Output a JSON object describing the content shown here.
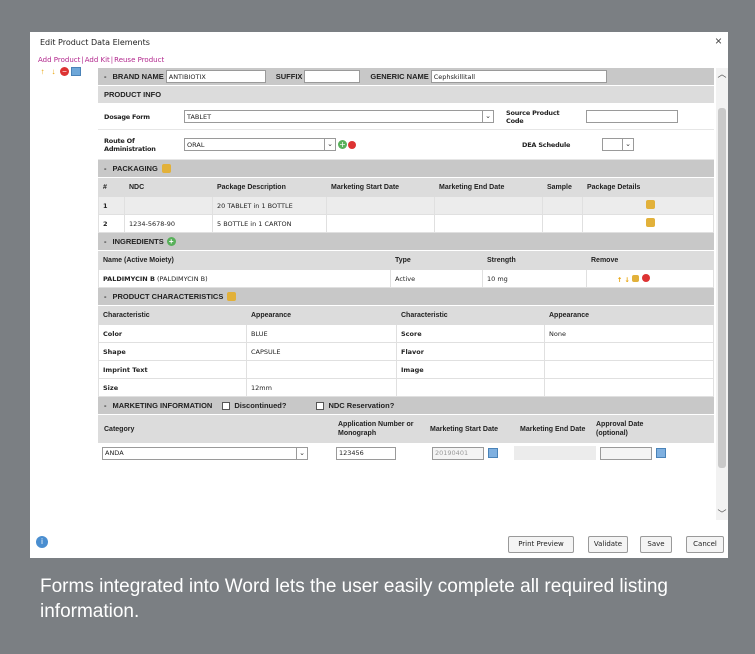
{
  "dialog": {
    "title": "Edit Product Data Elements",
    "close": "×",
    "links": [
      "Add Product",
      "Add Kit",
      "Reuse Product"
    ]
  },
  "brand": {
    "brand_label": "BRAND NAME",
    "brand_value": "ANTIBIOTIX",
    "suffix_label": "SUFFIX",
    "suffix_value": "",
    "generic_label": "GENERIC NAME",
    "generic_value": "Cephskillitall"
  },
  "product_info": {
    "header": "PRODUCT INFO",
    "dosage_label": "Dosage Form",
    "dosage_value": "TABLET",
    "source_label": "Source Product Code",
    "route_label": "Route Of Administration",
    "route_value": "ORAL",
    "dea_label": "DEA Schedule",
    "dea_value": ""
  },
  "packaging": {
    "header": "PACKAGING",
    "columns": [
      "#",
      "NDC",
      "Package Description",
      "Marketing Start Date",
      "Marketing End Date",
      "Sample",
      "Package Details"
    ],
    "rows": [
      {
        "num": "1",
        "ndc": "",
        "desc": "20 TABLET in 1 BOTTLE"
      },
      {
        "num": "2",
        "ndc": "1234-5678-90",
        "desc": "5 BOTTLE in 1 CARTON"
      }
    ]
  },
  "ingredients": {
    "header": "INGREDIENTS",
    "columns": [
      "Name (Active Moiety)",
      "Type",
      "Strength",
      "Remove"
    ],
    "row": {
      "name_bold": "PALDIMYCIN B",
      "name_rest": " (PALDIMYCIN B)",
      "type": "Active",
      "strength": "10 mg"
    }
  },
  "characteristics": {
    "header": "PRODUCT CHARACTERISTICS",
    "columns": [
      "Characteristic",
      "Appearance",
      "Characteristic",
      "Appearance"
    ],
    "rows": [
      {
        "c1": "Color",
        "a1": "BLUE",
        "c2": "Score",
        "a2": "None"
      },
      {
        "c1": "Shape",
        "a1": "CAPSULE",
        "c2": "Flavor",
        "a2": ""
      },
      {
        "c1": "Imprint Text",
        "a1": "",
        "c2": "Image",
        "a2": ""
      },
      {
        "c1": "Size",
        "a1": "12mm",
        "c2": "",
        "a2": ""
      }
    ]
  },
  "marketing": {
    "header": "MARKETING INFORMATION",
    "discontinued_label": "Discontinued?",
    "ndc_reservation_label": "NDC Reservation?",
    "columns": {
      "category": "Category",
      "application": "Application Number or Monograph",
      "start": "Marketing Start Date",
      "end": "Marketing End Date",
      "approval": "Approval Date (optional)"
    },
    "category_value": "ANDA",
    "application_value": "123456",
    "start_value": "20190401",
    "approval_value": ""
  },
  "buttons": {
    "print_preview": "Print Preview",
    "validate": "Validate",
    "save": "Save",
    "cancel": "Cancel"
  },
  "caption": "Forms integrated into Word lets the user easily complete all required listing information."
}
